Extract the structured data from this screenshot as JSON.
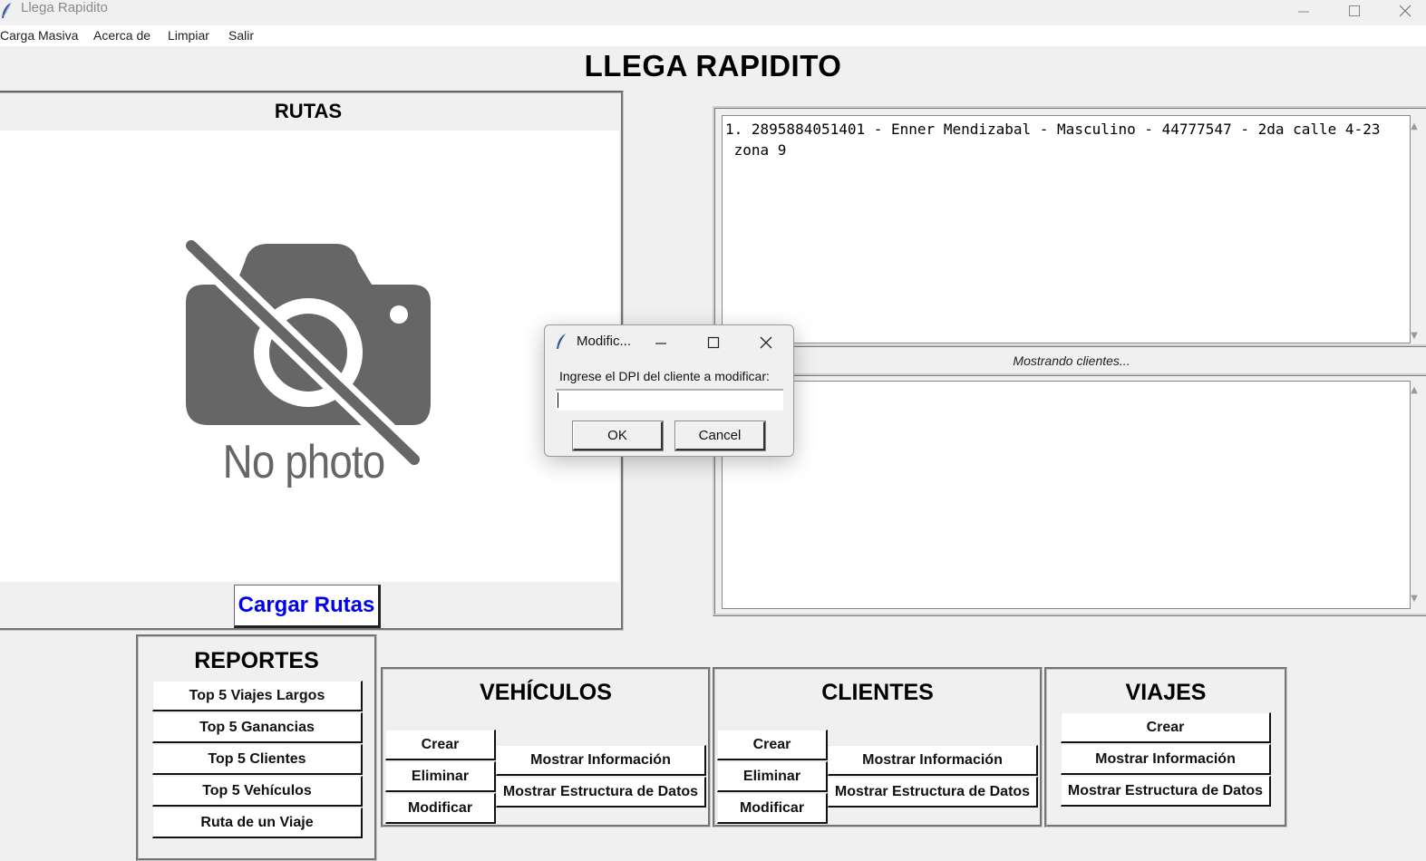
{
  "window": {
    "title": "Llega Rapidito",
    "icon": "feather-icon"
  },
  "menu": [
    "Carga Masiva",
    "Acerca de",
    "Limpiar",
    "Salir"
  ],
  "header": {
    "title": "LLEGA RAPIDITO"
  },
  "rutas": {
    "title": "RUTAS",
    "image_text": "No photo",
    "load_button": "Cargar Rutas"
  },
  "clients_display": {
    "text": "1. 2895884051401 - Enner Mendizabal - Masculino - 44777547 - 2da calle 4-23\n zona 9",
    "status": "Mostrando clientes..."
  },
  "reportes": {
    "title": "REPORTES",
    "buttons": [
      "Top 5 Viajes Largos",
      "Top 5 Ganancias",
      "Top 5 Clientes",
      "Top 5 Vehículos",
      "Ruta de un Viaje"
    ]
  },
  "vehiculos": {
    "title": "VEHÍCULOS",
    "crud": [
      "Crear",
      "Eliminar",
      "Modificar"
    ],
    "info": [
      "Mostrar Información",
      "Mostrar Estructura de Datos"
    ]
  },
  "clientes": {
    "title": "CLIENTES",
    "crud": [
      "Crear",
      "Eliminar",
      "Modificar"
    ],
    "info": [
      "Mostrar Información",
      "Mostrar Estructura de Datos"
    ]
  },
  "viajes": {
    "title": "VIAJES",
    "buttons": [
      "Crear",
      "Mostrar Información",
      "Mostrar Estructura de Datos"
    ]
  },
  "dialog": {
    "title": "Modific...",
    "prompt": "Ingrese el DPI del cliente a modificar:",
    "input_value": "",
    "ok": "OK",
    "cancel": "Cancel"
  }
}
